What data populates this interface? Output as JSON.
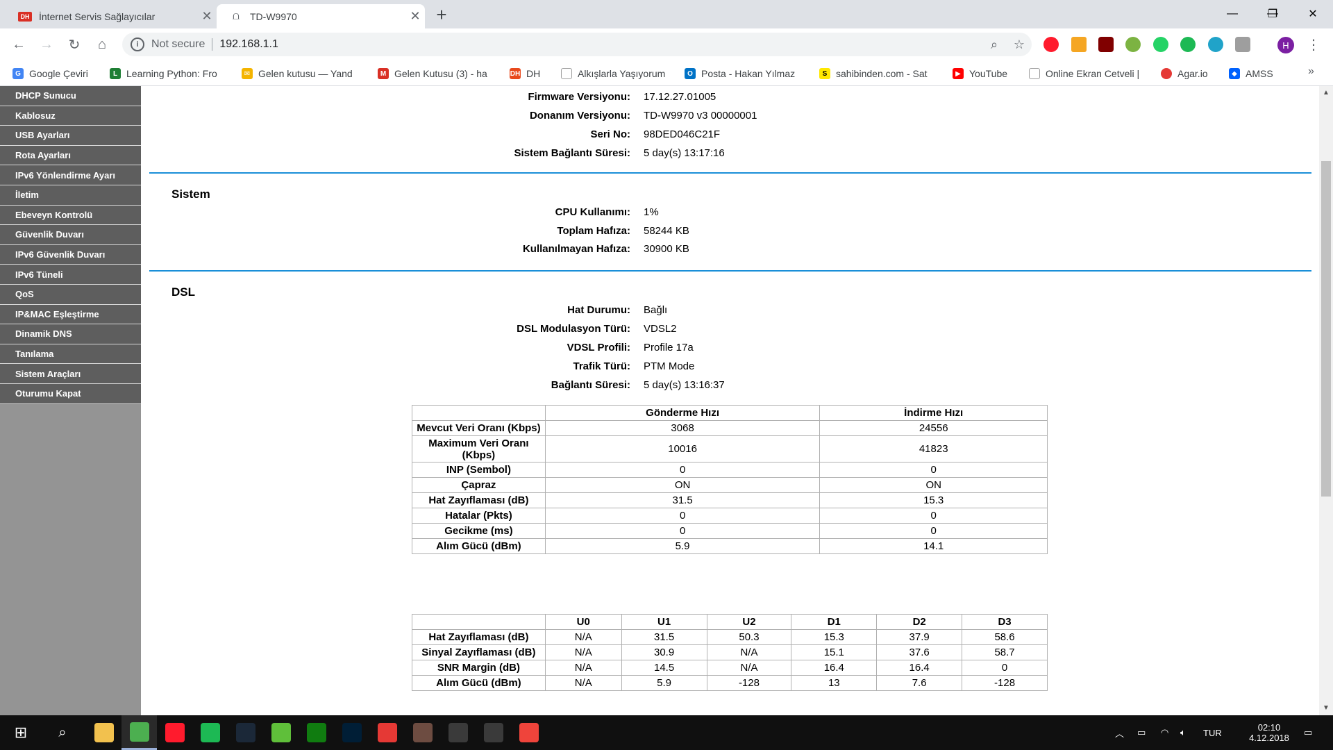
{
  "browser": {
    "tabs": [
      {
        "title": "İnternet Servis Sağlayıcılar",
        "favicon": "DH",
        "active": false
      },
      {
        "title": "TD-W9970",
        "favicon": "router",
        "active": true
      }
    ],
    "address": {
      "security": "Not secure",
      "url": "192.168.1.1"
    },
    "profile_initial": "H",
    "bookmarks": [
      {
        "label": "Google Çeviri",
        "icon": "google-translate-icon",
        "color": "#4285f4"
      },
      {
        "label": "Learning Python: Fro",
        "icon": "book-icon",
        "color": "#1e7e34"
      },
      {
        "label": "Gelen kutusu — Yand",
        "icon": "mail-icon",
        "color": "#f4b400"
      },
      {
        "label": "Gelen Kutusu (3) - ha",
        "icon": "gmail-icon",
        "color": "#d93025"
      },
      {
        "label": "DH",
        "icon": "dh-icon",
        "color": "#e8491d"
      },
      {
        "label": "Alkışlarla Yaşıyorum",
        "icon": "page-icon",
        "color": "#9e9e9e"
      },
      {
        "label": "Posta - Hakan Yılmaz",
        "icon": "outlook-icon",
        "color": "#0072c6"
      },
      {
        "label": "sahibinden.com - Sat",
        "icon": "sahibinden-icon",
        "color": "#ffe800"
      },
      {
        "label": "YouTube",
        "icon": "youtube-icon",
        "color": "#ff0000"
      },
      {
        "label": "Online Ekran Cetveli |",
        "icon": "page-icon",
        "color": "#9e9e9e"
      },
      {
        "label": "Agar.io",
        "icon": "agar-icon",
        "color": "#e53935"
      },
      {
        "label": "AMSS",
        "icon": "dropbox-icon",
        "color": "#0061fe"
      }
    ],
    "bookmarks_more": "»"
  },
  "sidebar": {
    "items": [
      "DHCP Sunucu",
      "Kablosuz",
      "USB Ayarları",
      "Rota Ayarları",
      "IPv6 Yönlendirme Ayarı",
      "İletim",
      "Ebeveyn Kontrolü",
      "Güvenlik Duvarı",
      "IPv6 Güvenlik Duvarı",
      "IPv6 Tüneli",
      "QoS",
      "IP&MAC Eşleştirme",
      "Dinamik DNS",
      "Tanılama",
      "Sistem Araçları",
      "Oturumu Kapat"
    ]
  },
  "device": {
    "firmware": {
      "label": "Firmware Versiyonu:",
      "value": "17.12.27.01005"
    },
    "hardware": {
      "label": "Donanım Versiyonu:",
      "value": "TD-W9970 v3 00000001"
    },
    "serial": {
      "label": "Seri No:",
      "value": "98DED046C21F"
    },
    "uptime": {
      "label": "Sistem Bağlantı Süresi:",
      "value": "5 day(s) 13:17:16"
    }
  },
  "system": {
    "title": "Sistem",
    "cpu": {
      "label": "CPU Kullanımı:",
      "value": "1%"
    },
    "total_mem": {
      "label": "Toplam Hafıza:",
      "value": "58244 KB"
    },
    "free_mem": {
      "label": "Kullanılmayan Hafıza:",
      "value": "30900 KB"
    }
  },
  "dsl": {
    "title": "DSL",
    "line_status": {
      "label": "Hat Durumu:",
      "value": "Bağlı"
    },
    "modulation": {
      "label": "DSL Modulasyon Türü:",
      "value": "VDSL2"
    },
    "profile": {
      "label": "VDSL Profili:",
      "value": "Profile 17a"
    },
    "traffic": {
      "label": "Trafik Türü:",
      "value": "PTM Mode"
    },
    "conn_time": {
      "label": "Bağlantı Süresi:",
      "value": "5 day(s) 13:16:37"
    },
    "rate_table": {
      "headers": [
        "",
        "Gönderme Hızı",
        "İndirme Hızı"
      ],
      "rows": [
        [
          "Mevcut Veri Oranı (Kbps)",
          "3068",
          "24556"
        ],
        [
          "Maximum Veri Oranı (Kbps)",
          "10016",
          "41823"
        ],
        [
          "INP (Sembol)",
          "0",
          "0"
        ],
        [
          "Çapraz",
          "ON",
          "ON"
        ],
        [
          "Hat Zayıflaması (dB)",
          "31.5",
          "15.3"
        ],
        [
          "Hatalar (Pkts)",
          "0",
          "0"
        ],
        [
          "Gecikme (ms)",
          "0",
          "0"
        ],
        [
          "Alım Gücü (dBm)",
          "5.9",
          "14.1"
        ]
      ]
    },
    "band_table": {
      "headers": [
        "",
        "U0",
        "U1",
        "U2",
        "D1",
        "D2",
        "D3"
      ],
      "rows": [
        [
          "Hat Zayıflaması (dB)",
          "N/A",
          "31.5",
          "50.3",
          "15.3",
          "37.9",
          "58.6"
        ],
        [
          "Sinyal Zayıflaması (dB)",
          "N/A",
          "30.9",
          "N/A",
          "15.1",
          "37.6",
          "58.7"
        ],
        [
          "SNR Margin (dB)",
          "N/A",
          "14.5",
          "N/A",
          "16.4",
          "16.4",
          "0"
        ],
        [
          "Alım Gücü (dBm)",
          "N/A",
          "5.9",
          "-128",
          "13",
          "7.6",
          "-128"
        ]
      ]
    }
  },
  "taskbar": {
    "apps": [
      {
        "name": "file-explorer-icon",
        "color": "#f2c14e"
      },
      {
        "name": "chrome-icon",
        "color": "#4caf50"
      },
      {
        "name": "opera-icon",
        "color": "#ff1b2d"
      },
      {
        "name": "spotify-icon",
        "color": "#1db954"
      },
      {
        "name": "steam-icon",
        "color": "#1b2838"
      },
      {
        "name": "camtasia-icon",
        "color": "#5fbf3a"
      },
      {
        "name": "xbox-icon",
        "color": "#107c10"
      },
      {
        "name": "photoshop-icon",
        "color": "#001e36"
      },
      {
        "name": "screen-recorder-icon",
        "color": "#e53935"
      },
      {
        "name": "minecraft-icon",
        "color": "#6d4c41"
      },
      {
        "name": "calculator-icon",
        "color": "#3a3a3a"
      },
      {
        "name": "calendar-icon",
        "color": "#3a3a3a"
      },
      {
        "name": "anydesk-icon",
        "color": "#ef443b"
      }
    ],
    "language": "TUR",
    "time": "02:10",
    "date": "4.12.2018"
  }
}
